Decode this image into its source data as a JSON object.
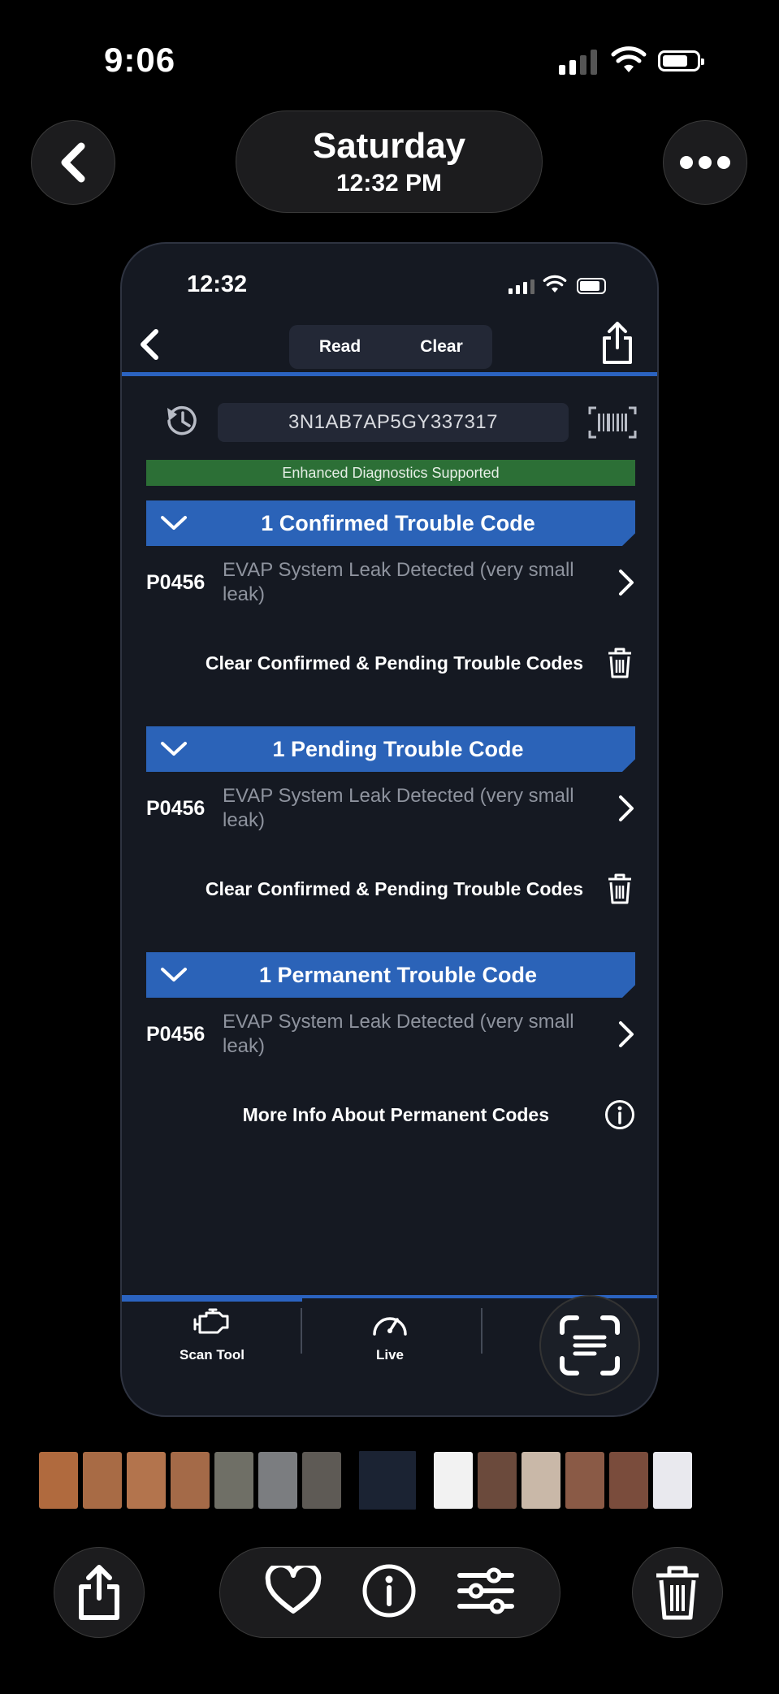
{
  "status_bar": {
    "time": "9:06"
  },
  "header": {
    "day": "Saturday",
    "time": "12:32 PM"
  },
  "screenshot": {
    "status_time": "12:32",
    "nav": {
      "read_label": "Read",
      "clear_label": "Clear"
    },
    "vin": "3N1AB7AP5GY337317",
    "enhanced_label": "Enhanced Diagnostics Supported",
    "sections": [
      {
        "title": "1 Confirmed Trouble Code",
        "code": "P0456",
        "description": "EVAP System Leak Detected (very small leak)",
        "action": "Clear Confirmed & Pending Trouble Codes",
        "action_icon": "trash-icon"
      },
      {
        "title": "1 Pending Trouble Code",
        "code": "P0456",
        "description": "EVAP System Leak Detected (very small leak)",
        "action": "Clear Confirmed & Pending Trouble Codes",
        "action_icon": "trash-icon"
      },
      {
        "title": "1 Permanent Trouble Code",
        "code": "P0456",
        "description": "EVAP System Leak Detected (very small leak)",
        "action": "More Info About Permanent Codes",
        "action_icon": "info-icon"
      }
    ],
    "tabs": [
      {
        "label": "Scan Tool",
        "icon": "engine-icon"
      },
      {
        "label": "Live",
        "icon": "gauge-icon"
      }
    ],
    "colors": {
      "accent": "#2b63b8",
      "enhanced": "#2c6f36",
      "background": "#151922"
    }
  },
  "thumbnail_colors": [
    "#b06a3e",
    "#a86b45",
    "#b3744d",
    "#a46a48",
    "#6f6f66",
    "#7b7d80",
    "#5e5a55",
    "#1b2333",
    "#f2f2f2",
    "#6b4a3c",
    "#c9b8a8",
    "#8a5a46",
    "#7a4c3c",
    "#e9e9ee",
    "#4a4a4a"
  ]
}
